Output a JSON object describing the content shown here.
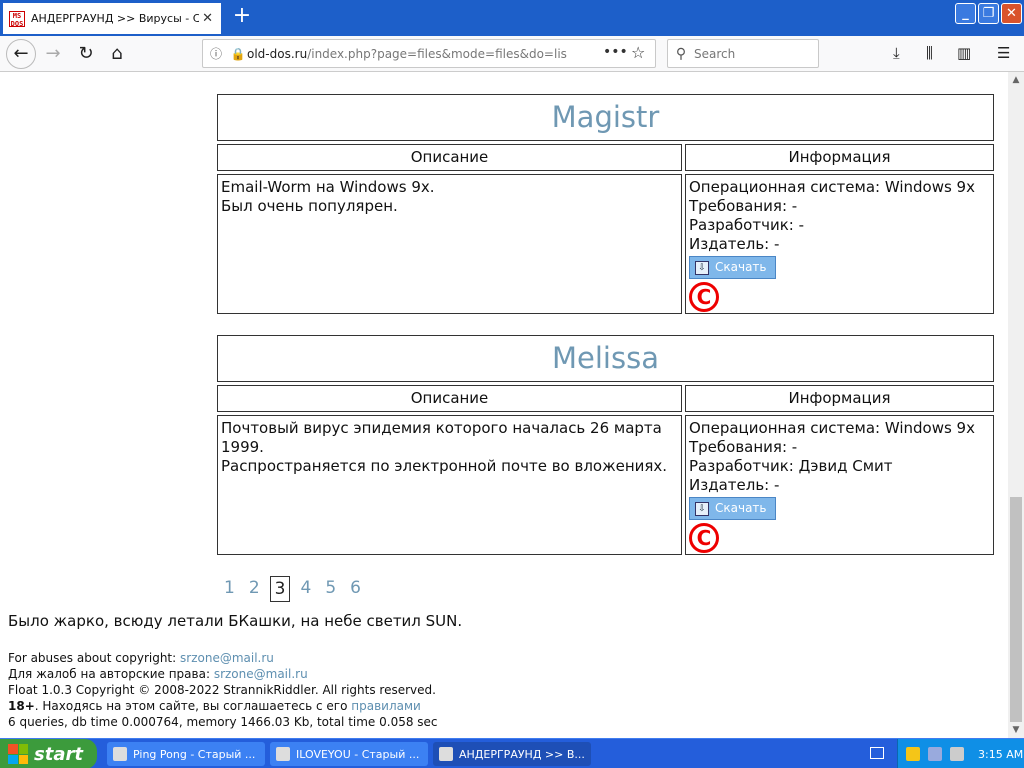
{
  "browser": {
    "tab_title": "АНДЕРГРАУНД >> Вирусы - Стр",
    "url_host": "old-dos.ru",
    "url_rest": "/index.php?page=files&mode=files&do=list&",
    "search_placeholder": "Search"
  },
  "entries": [
    {
      "title": "Magistr",
      "desc_header": "Описание",
      "info_header": "Информация",
      "description": [
        "Email-Worm на Windows 9x.",
        "Был очень популярен."
      ],
      "info": [
        "Операционная система: Windows 9x",
        "Требования: -",
        "Разработчик: -",
        "Издатель: -"
      ],
      "download_label": "Скачать"
    },
    {
      "title": "Melissa",
      "desc_header": "Описание",
      "info_header": "Информация",
      "description": [
        "Почтовый вирус эпидемия которого началась 26 марта 1999.",
        "Распространяется по электронной почте во вложениях."
      ],
      "info": [
        "Операционная система: Windows 9x",
        "Требования: -",
        "Разработчик: Дэвид Смит",
        "Издатель: -"
      ],
      "download_label": "Скачать"
    }
  ],
  "pager": {
    "pages": [
      "1",
      "2",
      "3",
      "4",
      "5",
      "6"
    ],
    "current": "3"
  },
  "footer": {
    "tagline": "Было жарко, всюду летали БКашки, на небе светил SUN.",
    "abuse_label": "For abuses about copyright:",
    "abuse_email": "srzone@mail.ru",
    "complaints_label": "Для жалоб на авторские права:",
    "complaints_email": "srzone@mail.ru",
    "copyright": "Float 1.0.3 Copyright © 2008-2022 StrannikRiddler. All rights reserved.",
    "age_bold": "18+",
    "age_text": ". Находясь на этом сайте, вы соглашаетесь с его",
    "rules_link": "правилами",
    "stats": "6 queries, db time 0.000764, memory 1466.03 Kb, total time 0.058 sec"
  },
  "taskbar": {
    "start_label": "start",
    "tasks": [
      "Ping Pong - Старый ...",
      "ILOVEYOU - Старый ...",
      "АНДЕРГРАУНД >> В..."
    ],
    "clock": "3:15 AM"
  }
}
